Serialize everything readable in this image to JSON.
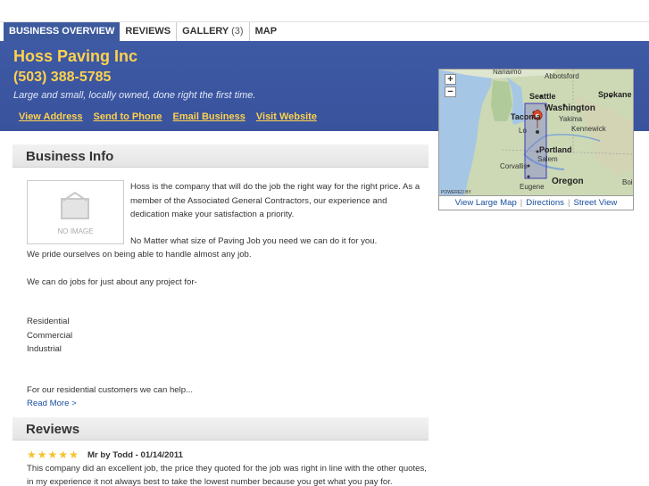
{
  "tabs": [
    {
      "label": "BUSINESS OVERVIEW",
      "count": ""
    },
    {
      "label": "REVIEWS",
      "count": ""
    },
    {
      "label": "GALLERY",
      "count": "(3)"
    },
    {
      "label": "MAP",
      "count": ""
    }
  ],
  "business": {
    "name": "Hoss Paving Inc",
    "phone": "(503) 388-5785",
    "tagline": "Large and small, locally owned, done right the first time."
  },
  "header_links": [
    "View Address",
    "Send to Phone",
    "Email Business",
    "Visit Website"
  ],
  "business_info": {
    "heading": "Business Info",
    "no_image_label": "NO IMAGE",
    "para1": "Hoss is the company that will do the job the right way for the right price. As a member of the Associated General Contractors, our experience and dedication make your satisfaction a priority.",
    "para2": "No Matter what size of Paving Job you need we can do it for you.",
    "line_pride": "We pride ourselves on being able to handle almost any job.",
    "line_projects": "We can do jobs for just about any project for-",
    "types": [
      "Residential",
      "Commercial",
      "Industrial"
    ],
    "line_residential": "For our residential customers we can help...",
    "read_more": "Read More >"
  },
  "reviews": {
    "heading": "Reviews",
    "rating": 5,
    "meta": "Mr by Todd - 01/14/2011",
    "text1": "This company did an excellent job, the price they quoted for the job was right in line with the other quotes,",
    "text2": "in my experience it not always best to take the lowest number because you get what you pay for."
  },
  "map": {
    "zoom_in": "+",
    "zoom_out": "−",
    "labels": {
      "nanaimo": "Nanaimo",
      "abbotsford": "Abbotsford",
      "seattle": "Seattle",
      "spokane": "Spokane",
      "washington": "Washington",
      "tacoma": "Tacoma",
      "yakima": "Yakima",
      "kennewick": "Kennewick",
      "portland": "Portland",
      "salem": "Salem",
      "corvallis": "Corvallis",
      "eugene": "Eugene",
      "oregon": "Oregon",
      "boise": "Boi",
      "longview": "Lo",
      "powered_by": "POWERED BY"
    },
    "links": [
      "View Large Map",
      "Directions",
      "Street View"
    ],
    "separator": "|",
    "colors": {
      "land": "#c9d7b3",
      "water": "#9fc3e6",
      "region": "#6b6bd6",
      "marker": "#d9472b"
    }
  }
}
